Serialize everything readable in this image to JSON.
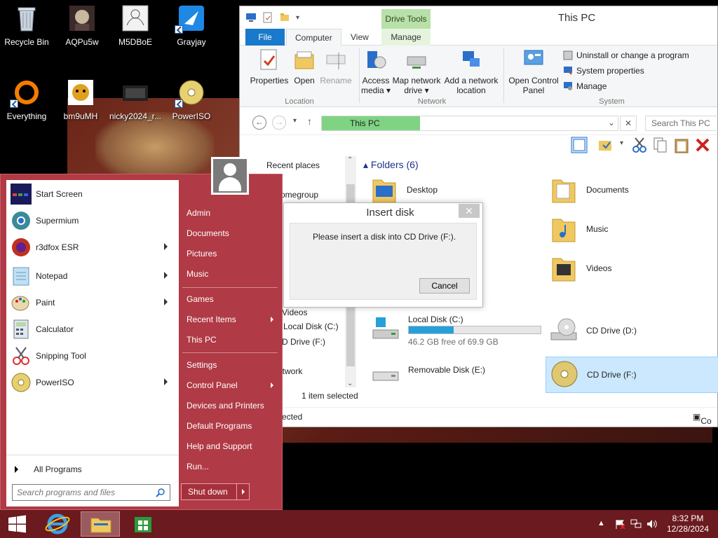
{
  "desktop": {
    "icons": [
      {
        "label": "Recycle Bin"
      },
      {
        "label": "AQPu5w"
      },
      {
        "label": "M5DBoE"
      },
      {
        "label": "Grayjay"
      },
      {
        "label": "Everything"
      },
      {
        "label": "bm9uMH"
      },
      {
        "label": "nicky2024_r..."
      },
      {
        "label": "PowerISO"
      }
    ]
  },
  "explorer": {
    "title": "This PC",
    "contextual_tab": "Drive Tools",
    "tabs": [
      "File",
      "Computer",
      "View",
      "Manage"
    ],
    "ribbon": {
      "location": {
        "label": "Location",
        "buttons": [
          "Properties",
          "Open",
          "Rename"
        ]
      },
      "network": {
        "label": "Network",
        "buttons": [
          "Access media ▾",
          "Map network drive ▾",
          "Add a network location"
        ]
      },
      "system": {
        "label": "System",
        "open_control_panel": "Open Control Panel",
        "items": [
          "Uninstall or change a program",
          "System properties",
          "Manage"
        ]
      }
    },
    "address": {
      "crumb": "This PC",
      "search_placeholder": "Search This PC"
    },
    "nav_pane": [
      "Recent places",
      "omegroup",
      "Videos",
      "Local Disk (C:)",
      "D Drive (F:)",
      "etwork"
    ],
    "folders_title": "Folders (6)",
    "folders": [
      "Desktop",
      "Documents",
      "Music",
      "Videos"
    ],
    "drives": [
      {
        "name": "Local Disk (C:)",
        "free": "46.2 GB free of 69.9 GB",
        "used_fraction": 0.34
      },
      {
        "name": "CD Drive (D:)"
      },
      {
        "name": "Removable Disk (E:)"
      },
      {
        "name": "CD Drive (F:)"
      }
    ],
    "status": {
      "count": "s",
      "selected": "1 item selected",
      "sub": "ected",
      "right": "Co"
    }
  },
  "dialog": {
    "title": "Insert disk",
    "message": "Please insert a disk into CD Drive (F:).",
    "cancel": "Cancel",
    "close": "✕"
  },
  "start_menu": {
    "programs": [
      {
        "label": "Start Screen"
      },
      {
        "label": "Supermium"
      },
      {
        "label": "r3dfox ESR"
      },
      {
        "label": "Notepad"
      },
      {
        "label": "Paint"
      },
      {
        "label": "Calculator"
      },
      {
        "label": "Snipping Tool"
      },
      {
        "label": "PowerISO"
      }
    ],
    "all_programs": "All Programs",
    "search_placeholder": "Search programs and files",
    "right": [
      "Admin",
      "Documents",
      "Pictures",
      "Music",
      "Games",
      "Recent Items",
      "This PC",
      "Settings",
      "Control Panel",
      "Devices and Printers",
      "Default Programs",
      "Help and Support",
      "Run..."
    ],
    "shutdown": "Shut down"
  },
  "taskbar": {
    "time": "8:32 PM",
    "date": "12/28/2024",
    "accent": "#6b1a1f"
  }
}
